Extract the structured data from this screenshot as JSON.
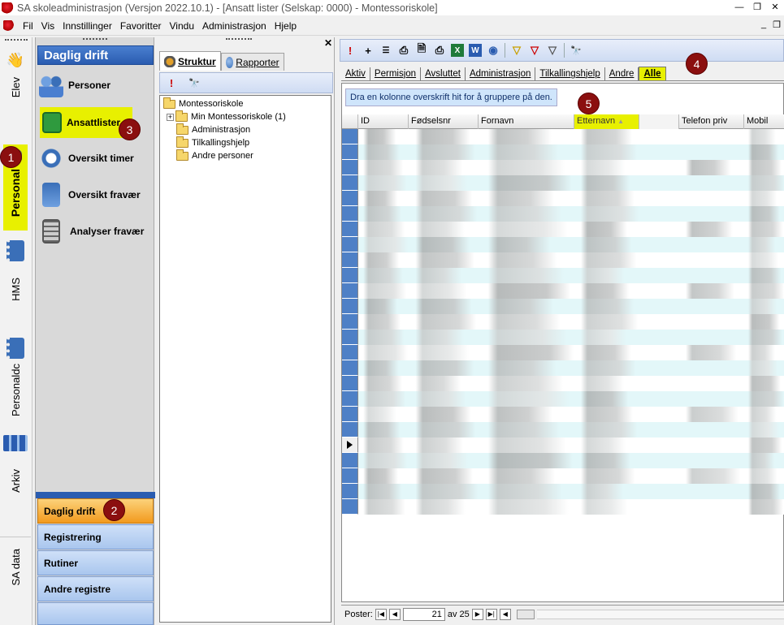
{
  "window": {
    "title": "SA skoleadministrasjon (Versjon 2022.10.1) - [Ansatt lister (Selskap: 0000) - Montessoriskole]"
  },
  "menu": [
    "Fil",
    "Vis",
    "Innstillinger",
    "Favoritter",
    "Vindu",
    "Administrasjon",
    "Hjelp"
  ],
  "vertical_tabs": [
    {
      "label": "Elev",
      "icon": "hands-icon"
    },
    {
      "label": "Personal",
      "icon": "people-icon",
      "active": true
    },
    {
      "label": "HMS",
      "icon": "notebook-icon"
    },
    {
      "label": "Personaldc",
      "icon": "notebook-icon"
    },
    {
      "label": "Arkiv",
      "icon": "binders-icon"
    },
    {
      "label": "SA data",
      "icon": ""
    }
  ],
  "nav": {
    "header": "Daglig drift",
    "items": [
      {
        "label": "Personer",
        "icon": "persons-icon"
      },
      {
        "label": "Ansattlister",
        "icon": "staff-list-icon",
        "active": true
      },
      {
        "label": "Oversikt timer",
        "icon": "clock-calendar-icon"
      },
      {
        "label": "Oversikt fravær",
        "icon": "absence-calendar-icon"
      },
      {
        "label": "Analyser fravær",
        "icon": "calculator-icon"
      }
    ],
    "bottom_buttons": [
      {
        "label": "Daglig drift",
        "active": true
      },
      {
        "label": "Registrering"
      },
      {
        "label": "Rutiner"
      },
      {
        "label": "Andre registre"
      }
    ]
  },
  "tree": {
    "tabs": [
      {
        "label": "Struktur",
        "active": true
      },
      {
        "label": "Rapporter"
      }
    ],
    "root": "Montessoriskole",
    "nodes": [
      {
        "label": "Min Montessoriskole (1)",
        "expandable": true
      },
      {
        "label": "Administrasjon"
      },
      {
        "label": "Tilkallingshjelp"
      },
      {
        "label": "Andre personer"
      }
    ]
  },
  "list": {
    "tabs": [
      {
        "label": "Aktiv"
      },
      {
        "label": "Permisjon"
      },
      {
        "label": "Avsluttet"
      },
      {
        "label": "Administrasjon"
      },
      {
        "label": "Tilkallingshjelp"
      },
      {
        "label": "Andre"
      },
      {
        "label": "Alle",
        "active": true
      }
    ],
    "group_hint": "Dra en kolonne overskrift hit for å gruppere på den.",
    "columns": [
      "ID",
      "Fødselsnr",
      "Fornavn",
      "Etternavn",
      "Telefon priv",
      "Mobil"
    ],
    "sorted_column": "Etternavn",
    "sort_indicator": "▲",
    "row_count_visible": 25,
    "current_row": 21,
    "status": {
      "label": "Poster:",
      "position": "21",
      "of_label": "av 25"
    }
  },
  "badges": [
    "1",
    "2",
    "3",
    "4",
    "5"
  ],
  "colors": {
    "highlight": "#e8f000",
    "accent": "#2a5cb0",
    "badge": "#8b0f0f"
  }
}
